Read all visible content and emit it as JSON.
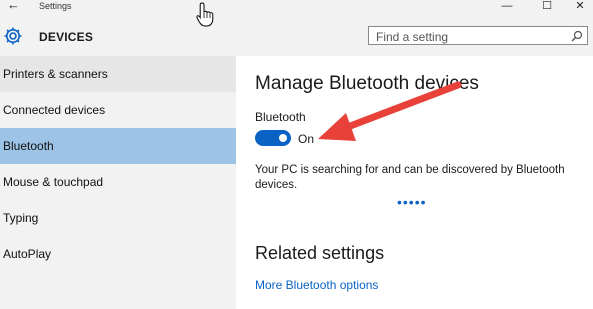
{
  "window": {
    "title": "Settings",
    "back_glyph": "←",
    "minimize_glyph": "—",
    "maximize_glyph": "☐",
    "close_glyph": "✕"
  },
  "header": {
    "section_icon": "gear-icon",
    "section_title": "DEVICES",
    "search_placeholder": "Find a setting",
    "search_icon": "search-icon"
  },
  "sidebar": {
    "items": [
      {
        "label": "Printers & scanners",
        "state": "hover"
      },
      {
        "label": "Connected devices",
        "state": "normal"
      },
      {
        "label": "Bluetooth",
        "state": "selected"
      },
      {
        "label": "Mouse & touchpad",
        "state": "normal"
      },
      {
        "label": "Typing",
        "state": "normal"
      },
      {
        "label": "AutoPlay",
        "state": "normal"
      }
    ]
  },
  "main": {
    "heading": "Manage Bluetooth devices",
    "bluetooth_label": "Bluetooth",
    "toggle_state": "On",
    "toggle_on": true,
    "description": "Your PC is searching for and can be discovered by Bluetooth devices.",
    "progress_dots": "•••••",
    "related_heading": "Related settings",
    "related_link": "More Bluetooth options"
  },
  "colors": {
    "accent": "#0a63c4",
    "selected_bg": "#9dc3e6",
    "sidebar_bg": "#f2f2f2",
    "annotation_arrow": "#e8413a"
  }
}
